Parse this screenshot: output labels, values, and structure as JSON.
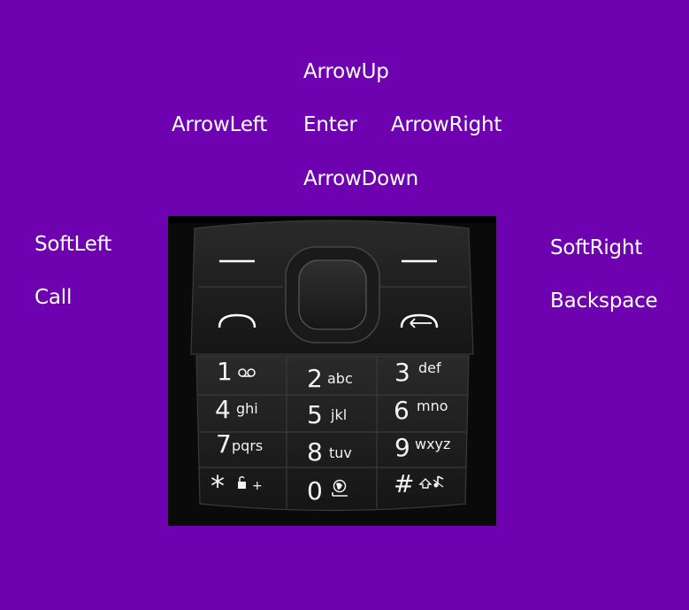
{
  "labels": {
    "arrow_up": "ArrowUp",
    "arrow_left": "ArrowLeft",
    "enter": "Enter",
    "arrow_right": "ArrowRight",
    "arrow_down": "ArrowDown",
    "soft_left": "SoftLeft",
    "call": "Call",
    "soft_right": "SoftRight",
    "backspace": "Backspace"
  },
  "keys": [
    {
      "digit": "1",
      "letters": "oo",
      "icon": "voicemail-icon"
    },
    {
      "digit": "2",
      "letters": "abc"
    },
    {
      "digit": "3",
      "letters": "def"
    },
    {
      "digit": "4",
      "letters": "ghi"
    },
    {
      "digit": "5",
      "letters": "jkl"
    },
    {
      "digit": "6",
      "letters": "mno"
    },
    {
      "digit": "7",
      "letters": "pqrs"
    },
    {
      "digit": "8",
      "letters": "tuv"
    },
    {
      "digit": "9",
      "letters": "wxyz"
    },
    {
      "digit": "*",
      "letters": "+",
      "icon": "lock-icon"
    },
    {
      "digit": "0",
      "letters": "",
      "icon": "globe-icon"
    },
    {
      "digit": "#",
      "letters": "",
      "icon": "shift-silent-icon"
    }
  ],
  "colors": {
    "background": "#6e02b1",
    "label_text": "#ffffff",
    "keypad_body": "#0a0a0a",
    "key_text": "#f2f2f2"
  }
}
